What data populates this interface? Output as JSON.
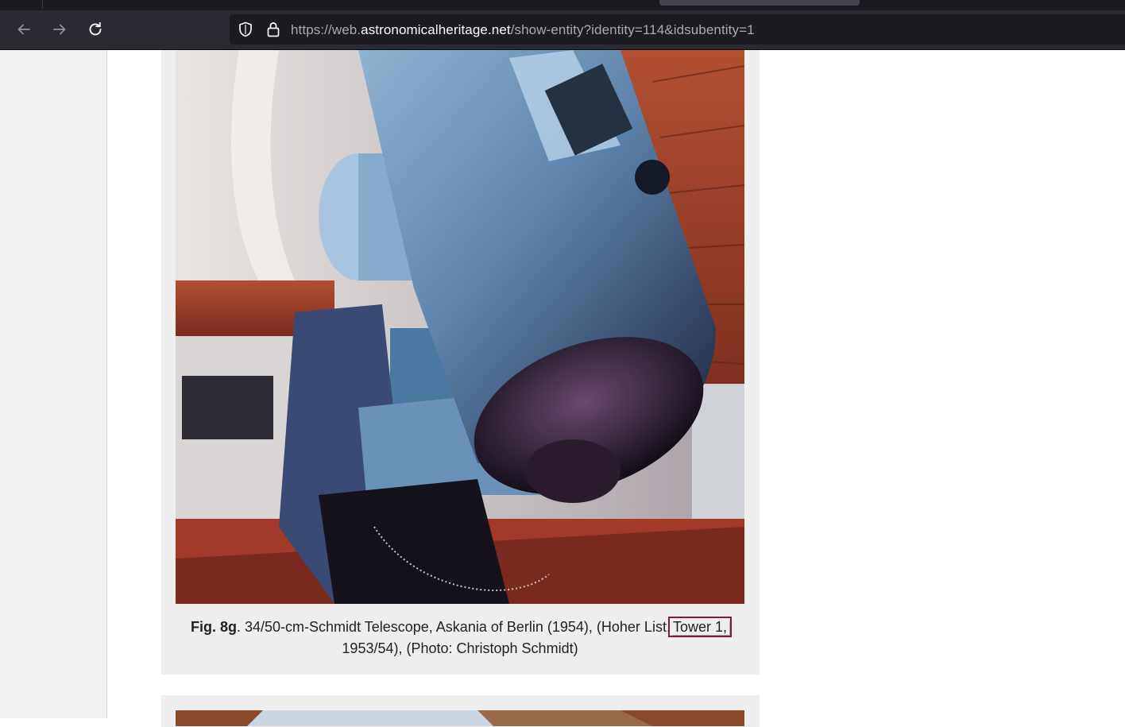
{
  "browser": {
    "url_prefix": "https://web.",
    "url_host": "astronomicalheritage.net",
    "url_path": "/show-entity?identity=114&idsubentity=1"
  },
  "figure": {
    "label": "Fig. 8g",
    "caption_part1": ". 34/50-cm-Schmidt Telescope, Askania of Berlin (1954), (Hoher List,",
    "caption_highlight": "Tower 1,",
    "caption_part2": "1953/54), (Photo: Christoph Schmidt)",
    "image_subject": "Schmidt telescope in observatory dome"
  },
  "icons": {
    "back": "arrow-left-icon",
    "forward": "arrow-right-icon",
    "reload": "reload-icon",
    "tracking": "shield-icon",
    "security": "lock-icon"
  },
  "colors": {
    "chrome_dark": "#2b2a33",
    "urlbar": "#1c1b22",
    "highlight_border": "#7a1d4a",
    "card_bg": "#eeeeee"
  }
}
